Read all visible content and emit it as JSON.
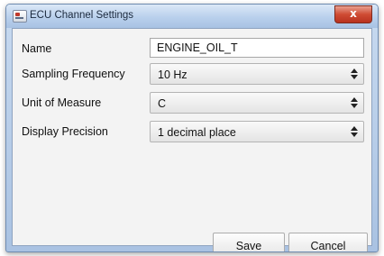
{
  "window": {
    "title": "ECU Channel Settings",
    "close_glyph": "x"
  },
  "form": {
    "name": {
      "label": "Name",
      "value": "ENGINE_OIL_T"
    },
    "sampling_frequency": {
      "label": "Sampling Frequency",
      "value": "10 Hz"
    },
    "unit_of_measure": {
      "label": "Unit of Measure",
      "value": "C"
    },
    "display_precision": {
      "label": "Display Precision",
      "value": "1 decimal place"
    }
  },
  "buttons": {
    "save": "Save",
    "cancel": "Cancel"
  },
  "icons": {
    "app": "ecu-app-icon",
    "close": "close-icon",
    "dropdown": "updown-arrow-icon"
  },
  "colors": {
    "titlebar": "#b9d0ec",
    "close_button": "#cf4b33",
    "client_background": "#f3f3f3"
  }
}
